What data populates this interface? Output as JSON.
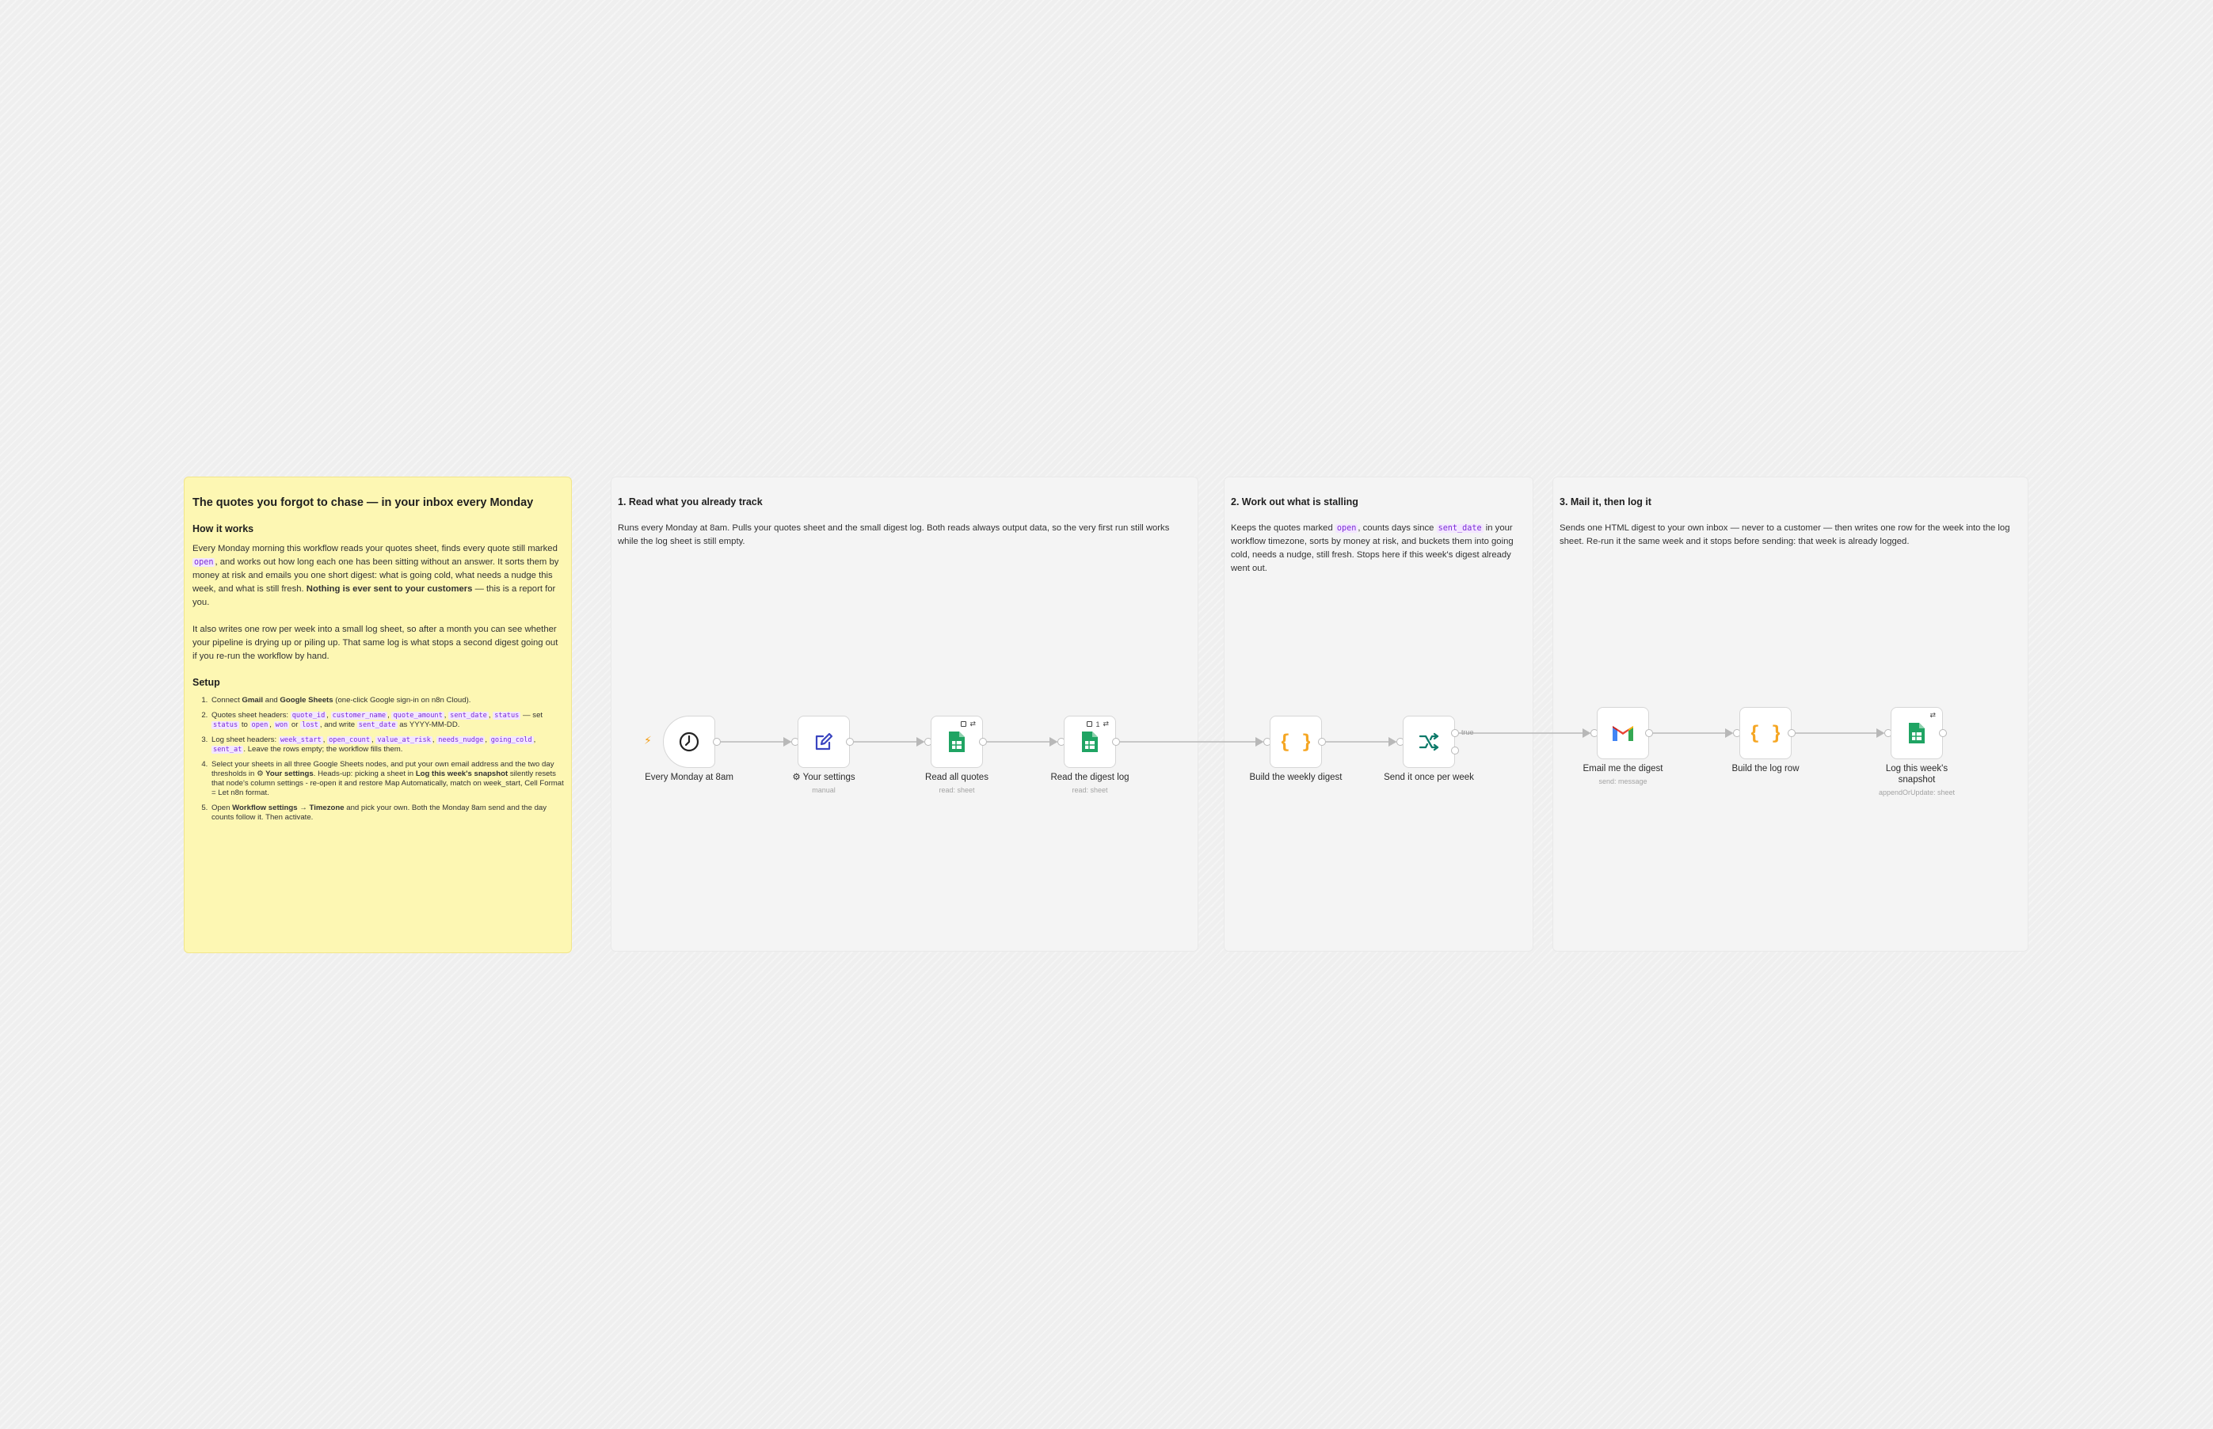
{
  "overview": {
    "title": "The quotes you forgot to chase — in your inbox every Monday",
    "how_heading": "How it works",
    "p1_a": "Every Monday morning this workflow reads your quotes sheet, finds every quote still marked ",
    "p1_code": "open",
    "p1_b": ", and works out how long each one has been sitting without an answer. It sorts them by money at risk and emails you one short digest: what is going cold, what needs a nudge this week, and what is still fresh. ",
    "p1_strong": "Nothing is ever sent to your customers",
    "p1_c": " — this is a report for you.",
    "p2": "It also writes one row per week into a small log sheet, so after a month you can see whether your pipeline is drying up or piling up. That same log is what stops a second digest going out if you re-run the workflow by hand.",
    "setup_heading": "Setup",
    "s1_a": "Connect ",
    "s1_b1": "Gmail",
    "s1_c": " and ",
    "s1_b2": "Google Sheets",
    "s1_d": " (one-click Google sign-in on n8n Cloud).",
    "s2_a": "Quotes sheet headers: ",
    "s2_c1": "quote_id",
    "s2_c2": "customer_name",
    "s2_c3": "quote_amount",
    "s2_c4": "sent_date",
    "s2_c5": "status",
    "s2_b": " — set ",
    "s2_c6": "status",
    "s2_to": " to ",
    "s2_c7": "open",
    "s2_c8": "won",
    "s2_or": " or ",
    "s2_c9": "lost",
    "s2_write": ", and write ",
    "s2_c10": "sent_date",
    "s2_end": " as YYYY-MM-DD.",
    "s3_a": "Log sheet headers: ",
    "s3_c1": "week_start",
    "s3_c2": "open_count",
    "s3_c3": "value_at_risk",
    "s3_c4": "needs_nudge",
    "s3_c5": "going_cold",
    "s3_c6": "sent_at",
    "s3_end": ". Leave the rows empty; the workflow fills them.",
    "s4_a": "Select your sheets in all three Google Sheets nodes, and put your own email address and the two day thresholds in ",
    "s4_b1": "⚙ Your settings",
    "s4_c": ". Heads-up: picking a sheet in ",
    "s4_b2": "Log this week's snapshot",
    "s4_d": " silently resets that node's column settings - re-open it and restore Map Automatically, match on week_start, Cell Format = Let n8n format.",
    "s5_a": "Open ",
    "s5_b1": "Workflow settings → Timezone",
    "s5_c": " and pick your own. Both the Monday 8am send and the day counts follow it. Then activate."
  },
  "sections": {
    "one": {
      "title": "1. Read what you already track",
      "desc": "Runs every Monday at 8am. Pulls your quotes sheet and the small digest log. Both reads always output data, so the very first run still works while the log sheet is still empty."
    },
    "two": {
      "title": "2. Work out what is stalling",
      "desc_a": "Keeps the quotes marked ",
      "code_a": "open",
      "desc_b": ", counts days since ",
      "code_b": "sent_date",
      "desc_c": " in your workflow timezone, sorts by money at risk, and buckets them into going cold, needs a nudge, still fresh. Stops here if this week's digest already went out."
    },
    "three": {
      "title": "3. Mail it, then log it",
      "desc": "Sends one HTML digest to your own inbox — never to a customer — then writes one row for the week into the log sheet. Re-run it the same week and it stops before sending: that week is already logged."
    }
  },
  "nodes": {
    "schedule": {
      "label": "Every Monday at 8am",
      "icon": "clock-icon"
    },
    "settings": {
      "label": "⚙ Your settings",
      "sub": "manual",
      "icon": "pencil-icon"
    },
    "read_quotes": {
      "label": "Read all quotes",
      "sub": "read: sheet",
      "icon": "sheets-icon"
    },
    "read_log": {
      "label": "Read the digest log",
      "sub": "read: sheet",
      "badge": "1",
      "icon": "sheets-icon"
    },
    "build_digest": {
      "label": "Build the weekly digest",
      "icon": "code-braces-icon"
    },
    "send_once": {
      "label": "Send it once per week",
      "icon": "if-branch-icon",
      "true_label": "true"
    },
    "email": {
      "label": "Email me the digest",
      "sub": "send: message",
      "icon": "gmail-icon"
    },
    "build_log": {
      "label": "Build the log row",
      "icon": "code-braces-icon"
    },
    "log_snapshot": {
      "label": "Log this week's snapshot",
      "sub": "appendOrUpdate: sheet",
      "icon": "sheets-icon"
    }
  },
  "colors": {
    "sticky_yellow": "#fdf7b3",
    "code_purple": "#7a2bd6",
    "sheets_green": "#1fa463",
    "code_orange": "#f5a623",
    "if_green": "#0d7a6a",
    "trigger_orange": "#f39c12"
  }
}
